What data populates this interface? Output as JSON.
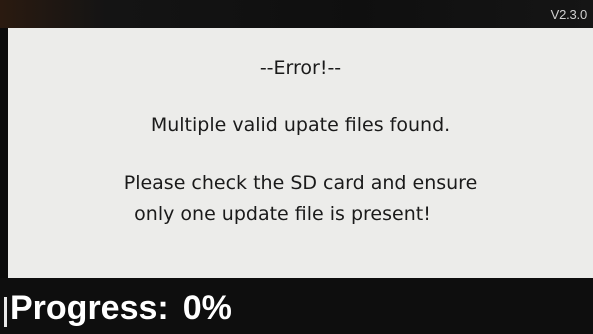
{
  "header": {
    "version": "V2.3.0"
  },
  "dialog": {
    "title": "--Error!--",
    "message": "Multiple valid upate files found.",
    "instruction_line1": "Please check the SD card and ensure",
    "instruction_line2": "only one update file is present!"
  },
  "footer": {
    "progress_label": "Progress:",
    "progress_value": "0%",
    "progress_fraction": 0
  }
}
